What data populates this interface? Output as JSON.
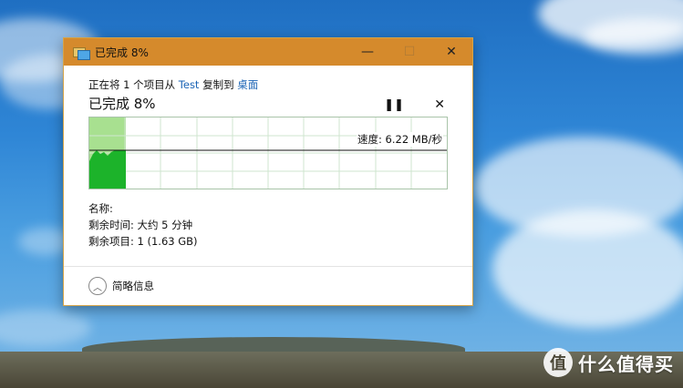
{
  "dialog": {
    "title": "已完成 8%",
    "controls": {
      "minimize": "—",
      "maximize": "☐",
      "close": "✕"
    },
    "copy_line": {
      "prefix": "正在将 1 个项目从 ",
      "source": "Test",
      "middle": " 复制到 ",
      "destination": "桌面"
    },
    "heading": "已完成 8%",
    "pause_glyph": "❚❚",
    "cancel_glyph": "✕",
    "speed": "速度: 6.22 MB/秒",
    "name_label": "名称:",
    "time_remaining": "剩余时间: 大约 5 分钟",
    "items_remaining": "剩余项目: 1 (1.63 GB)",
    "more_details": "简略信息",
    "progress": 0.08
  },
  "watermark": {
    "text": "什么值得买",
    "logo": "值"
  },
  "colors": {
    "titlebar": "#d58a2c",
    "progress_fill": "#a8e090",
    "graph_fill": "#1cb32a",
    "link": "#1a63b5"
  }
}
